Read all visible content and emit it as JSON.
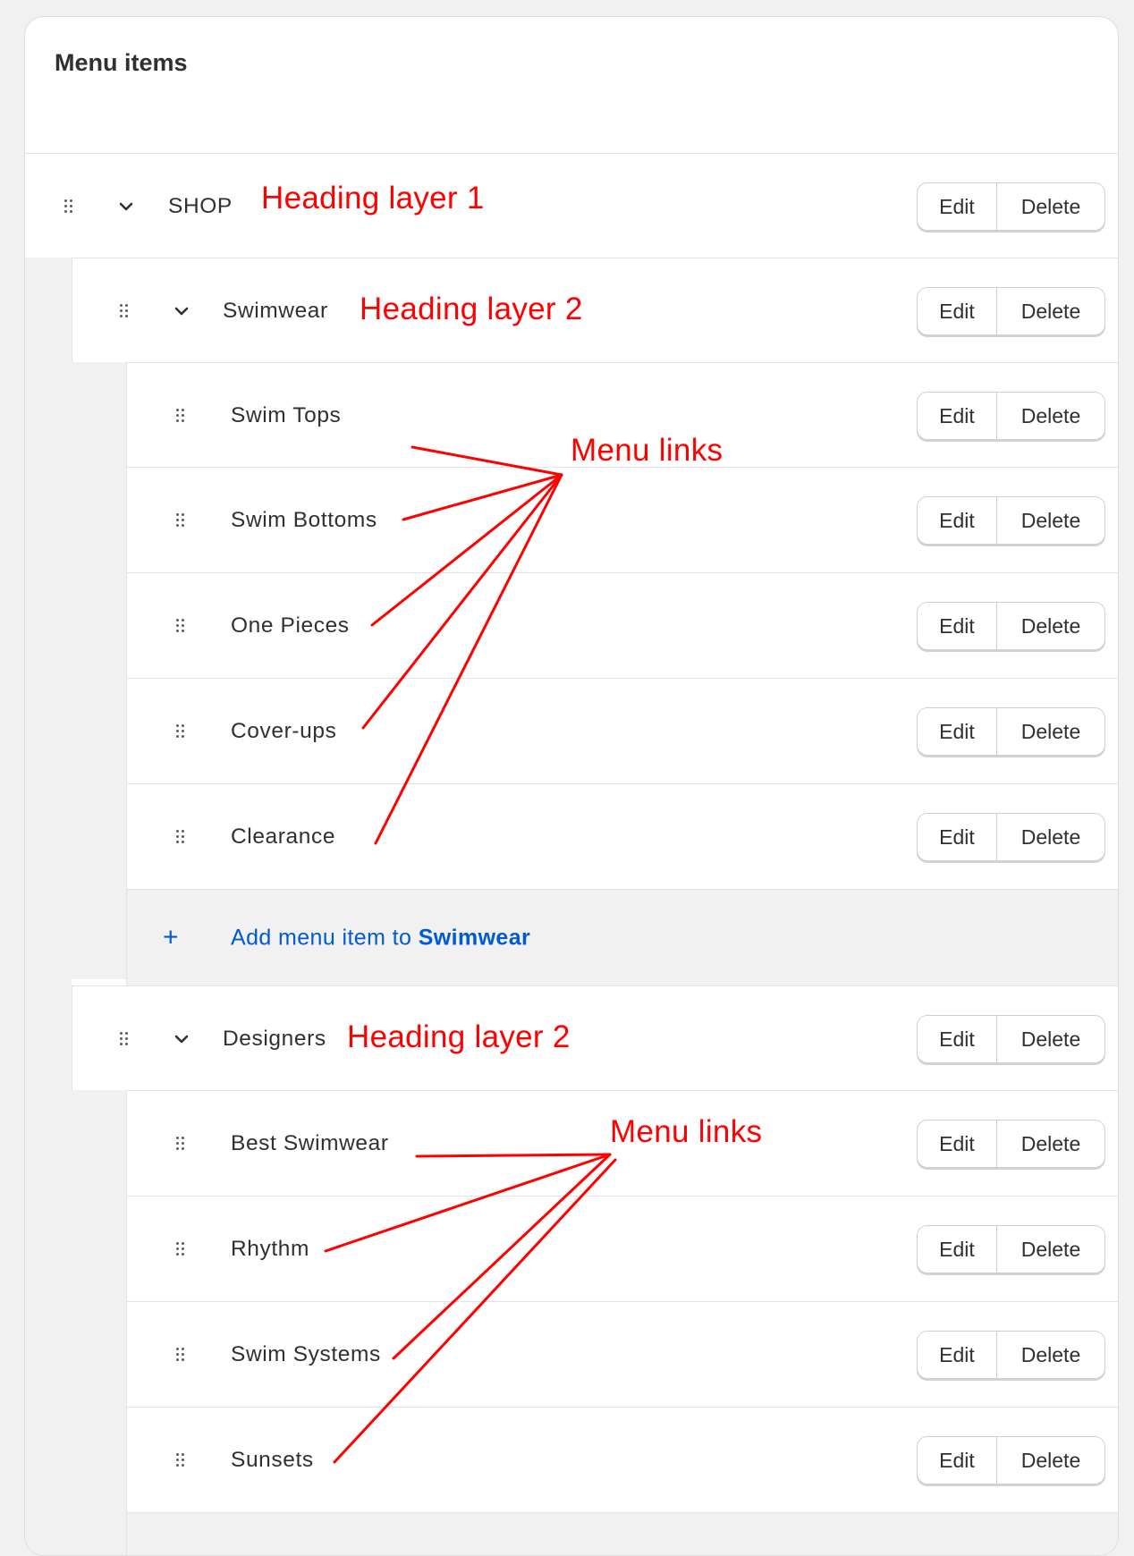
{
  "card": {
    "title": "Menu items"
  },
  "items": {
    "shop": {
      "label": "SHOP"
    },
    "swimwear": {
      "label": "Swimwear"
    },
    "swim_tops": {
      "label": "Swim Tops"
    },
    "swim_bottoms": {
      "label": "Swim Bottoms"
    },
    "one_pieces": {
      "label": "One Pieces"
    },
    "cover_ups": {
      "label": "Cover-ups"
    },
    "clearance": {
      "label": "Clearance"
    },
    "designers": {
      "label": "Designers"
    },
    "best_swimwear": {
      "label": "Best Swimwear"
    },
    "rhythm": {
      "label": "Rhythm"
    },
    "swim_systems": {
      "label": "Swim Systems"
    },
    "sunsets": {
      "label": "Sunsets"
    }
  },
  "actions": {
    "edit": "Edit",
    "delete": "Delete"
  },
  "add_item": {
    "plus": "+",
    "prefix": "Add menu item to ",
    "target": "Swimwear"
  },
  "annotations": {
    "heading1": "Heading layer 1",
    "heading2_swimwear": "Heading layer 2",
    "heading2_designers": "Heading layer 2",
    "menu_links_1": "Menu links",
    "menu_links_2": "Menu links"
  },
  "colors": {
    "annotation": "#ff0000",
    "link": "#005bd3",
    "background": "#f1f1f1"
  }
}
